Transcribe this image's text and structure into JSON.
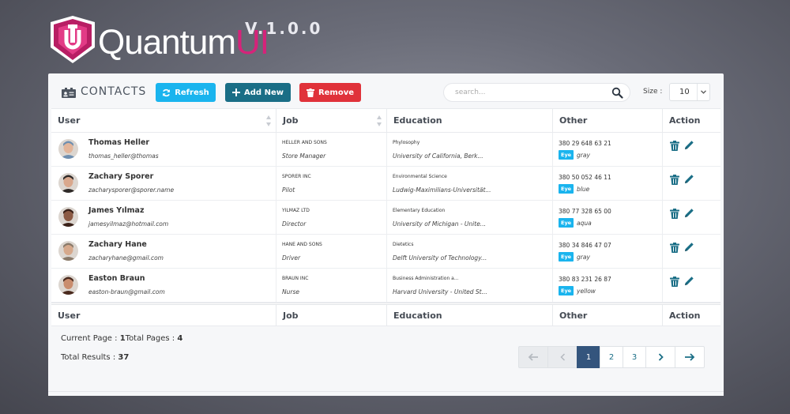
{
  "brand": {
    "name_main": "Quantum",
    "name_accent": "UI",
    "version": "V.1.0.0",
    "accent_color": "#d6237a"
  },
  "toolbar": {
    "title": "CONTACTS",
    "icon": "contacts-card-icon",
    "refresh_label": "Refresh",
    "add_label": "Add New",
    "remove_label": "Remove",
    "search_placeholder": "search...",
    "size_label": "Size :",
    "size_value": "10"
  },
  "table": {
    "headers": [
      "User",
      "Job",
      "Education",
      "Other",
      "Action"
    ],
    "rows": [
      {
        "name": "Thomas Heller",
        "email": "thomas_heller@thomas",
        "company": "HELLER AND SONS",
        "job": "Store Manager",
        "field": "Phylosophy",
        "school": "University of California, Berk...",
        "phone": "380 29 648 63 21",
        "eye_label": "Eye",
        "eye": "gray",
        "avatar_color": "#6f8fb0",
        "avatar_skin": "#e2b59a"
      },
      {
        "name": "Zachary Sporer",
        "email": "zacharysporer@sporer.name",
        "company": "SPORER INC",
        "job": "Pilot",
        "field": "Environmental Science",
        "school": "Ludwig-Maximilians-Universität...",
        "phone": "380 50 052 46 11",
        "eye_label": "Eye",
        "eye": "blue",
        "avatar_color": "#2f2a28",
        "avatar_skin": "#d9a88d"
      },
      {
        "name": "James Yılmaz",
        "email": "jamesyilmaz@hotmail.com",
        "company": "YILMAZ LTD",
        "job": "Director",
        "field": "Elementary Education",
        "school": "University of Michigan - Unite...",
        "phone": "380 77 328 65 00",
        "eye_label": "Eye",
        "eye": "aqua",
        "avatar_color": "#3a2118",
        "avatar_skin": "#8c5a44"
      },
      {
        "name": "Zachary Hane",
        "email": "zacharyhane@gmail.com",
        "company": "HANE AND SONS",
        "job": "Driver",
        "field": "Dietetics",
        "school": "Delft University of Technology...",
        "phone": "380 34 846 47 07",
        "eye_label": "Eye",
        "eye": "gray",
        "avatar_color": "#8a7a6a",
        "avatar_skin": "#d6a98c"
      },
      {
        "name": "Easton Braun",
        "email": "easton-braun@gmail.com",
        "company": "BRAUN INC",
        "job": "Nurse",
        "field": "Business Administration a...",
        "school": "Harvard University - United St...",
        "phone": "380 83 231 26 87",
        "eye_label": "Eye",
        "eye": "yellow",
        "avatar_color": "#4a2a1e",
        "avatar_skin": "#c98d6e"
      }
    ]
  },
  "footer": {
    "current_page_label": "Current Page :",
    "current_page": "1",
    "total_pages_label": "Total Pages :",
    "total_pages": "4",
    "total_results_label": "Total Results :",
    "total_results": "37"
  },
  "pagination": {
    "first": "←",
    "prev": "‹",
    "pages": [
      "1",
      "2",
      "3"
    ],
    "active_page": "1",
    "next": "›",
    "last": "→"
  }
}
